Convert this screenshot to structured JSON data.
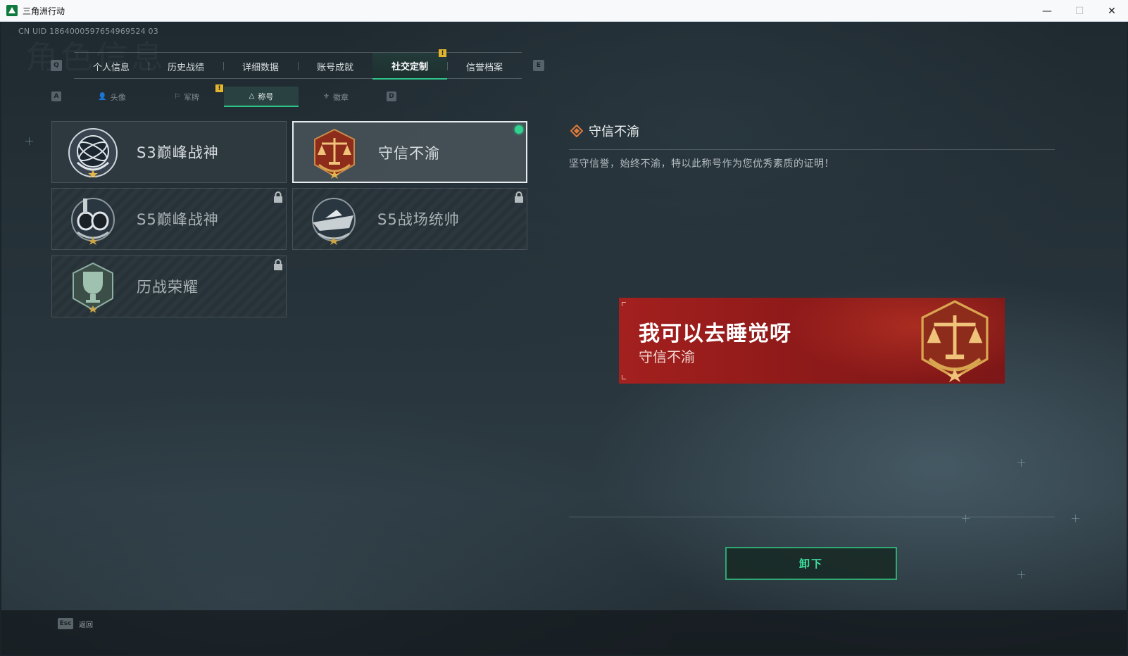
{
  "window": {
    "title": "三角洲行动",
    "minimize": "—",
    "maximize": "☐",
    "close": "✕"
  },
  "uid": "CN UID 1864000597654969524 03",
  "watermark": "角色信息",
  "tabs": {
    "left_key": "Q",
    "right_key": "E",
    "items": [
      {
        "label": "个人信息"
      },
      {
        "label": "历史战绩"
      },
      {
        "label": "详细数据"
      },
      {
        "label": "账号成就"
      },
      {
        "label": "社交定制",
        "active": true,
        "notice": "!"
      },
      {
        "label": "信誉档案"
      }
    ]
  },
  "subtabs": {
    "left_key": "A",
    "right_key": "D",
    "items": [
      {
        "icon": "person-icon",
        "glyph": "👤",
        "label": "头像"
      },
      {
        "icon": "flag-icon",
        "glyph": "⚐",
        "label": "军牌",
        "notice": "!"
      },
      {
        "icon": "triangle-icon",
        "glyph": "△",
        "label": "称号",
        "active": true
      },
      {
        "icon": "badge-icon",
        "glyph": "⚜",
        "label": "徽章"
      }
    ]
  },
  "titles": [
    {
      "name": "S3巅峰战神",
      "status": "unlocked",
      "emblem": "armillary-emblem"
    },
    {
      "name": "守信不渝",
      "status": "equipped",
      "emblem": "scales-emblem"
    },
    {
      "name": "S5巅峰战神",
      "status": "locked",
      "emblem": "diving-mask-emblem"
    },
    {
      "name": "S5战场统帅",
      "status": "locked",
      "emblem": "boat-emblem"
    },
    {
      "name": "历战荣耀",
      "status": "locked",
      "emblem": "trophy-emblem"
    }
  ],
  "detail": {
    "title": "守信不渝",
    "description": "坚守信誉，始终不渝，特以此称号作为您优秀素质的证明！"
  },
  "banner": {
    "nickname": "我可以去睡觉呀",
    "title": "守信不渝"
  },
  "unequip_label": "卸下",
  "esc": {
    "key": "Esc",
    "label": "返回"
  },
  "colors": {
    "accent": "#2fc58a",
    "banner": "#9a1e1c",
    "notice": "#e2b52a"
  }
}
